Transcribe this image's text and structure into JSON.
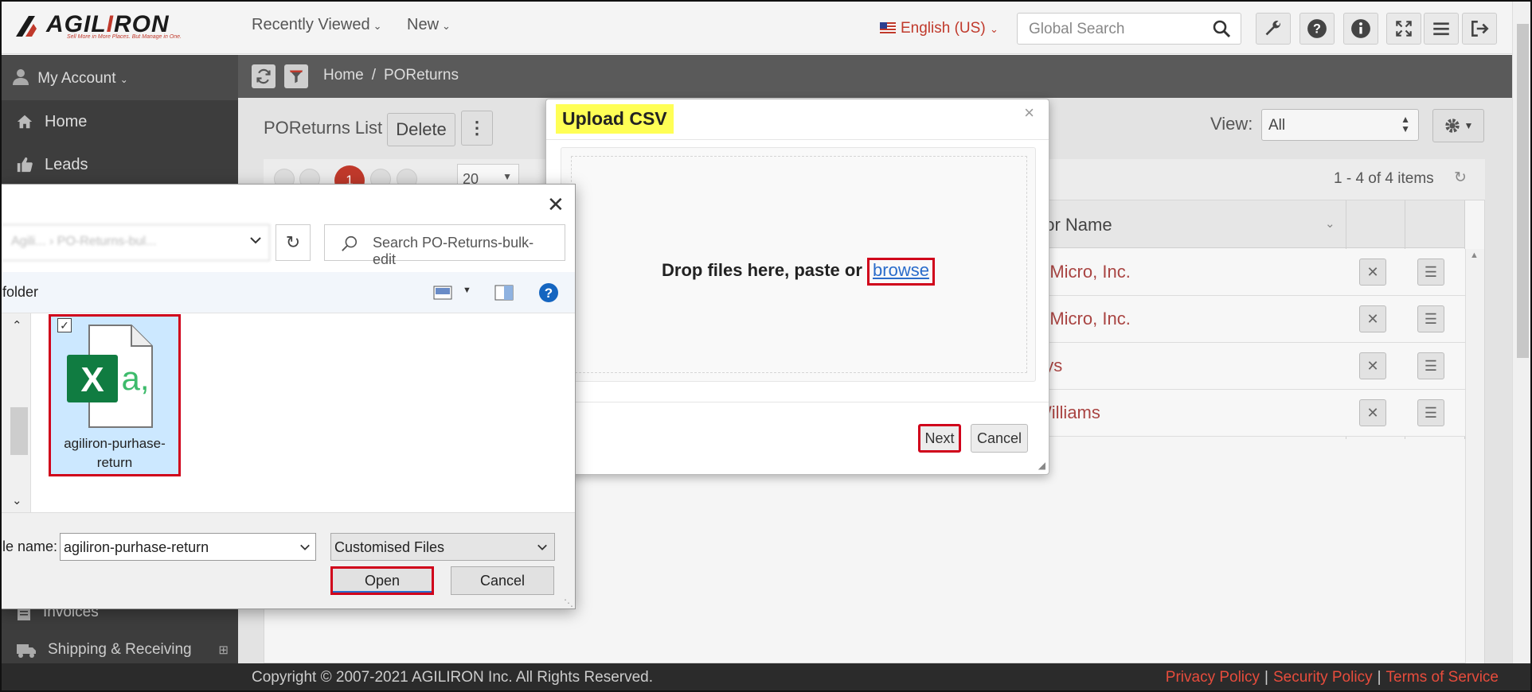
{
  "header": {
    "brand_left": "AGIL",
    "brand_accent": "I",
    "brand_right": "RON",
    "tagline": "Sell More in More Places. But Manage in One.",
    "nav": [
      "Recently Viewed",
      "New"
    ],
    "language": "English (US)",
    "search_placeholder": "Global Search",
    "icons": [
      "wrench-icon",
      "help-icon",
      "info-icon",
      "expand-icon",
      "menu-icon",
      "logout-icon"
    ]
  },
  "sidebar": {
    "account": "My Account",
    "items": [
      "Home",
      "Leads"
    ],
    "bottom_items": [
      "Invoices",
      "Shipping & Receiving"
    ]
  },
  "breadcrumb": {
    "home": "Home",
    "sep": "/",
    "current": "POReturns"
  },
  "list": {
    "title": "POReturns List",
    "delete_label": "Delete",
    "view_label": "View:",
    "view_value": "All",
    "page_size": "20",
    "current_page": "1",
    "count": "1 - 4 of 4 items",
    "column_header": "dor Name",
    "rows": [
      "d Micro, Inc.",
      "d Micro, Inc.",
      "nys",
      "Williams"
    ]
  },
  "modal": {
    "title": "Upload CSV",
    "close": "×",
    "drop_text": "Drop files here, paste or ",
    "browse": "browse",
    "next": "Next",
    "cancel": "Cancel"
  },
  "file_dialog": {
    "close": "✕",
    "path": "Agili... › PO-Returns-bul...",
    "search_placeholder": "Search PO-Returns-bulk-edit",
    "folder_label": "folder",
    "file_name": "agiliron-purhase-return",
    "file_name_line1": "agiliron-purhase-",
    "file_name_line2": "return",
    "file_name_label": "le name:",
    "file_type": "Customised Files",
    "open": "Open",
    "cancel": "Cancel"
  },
  "footer": {
    "copyright": "Copyright © 2007-2021 AGILIRON Inc. All Rights Reserved.",
    "privacy": "Privacy Policy",
    "security": "Security Policy",
    "terms": "Terms of Service",
    "separator": "|"
  },
  "colors": {
    "accent_red": "#c0392b",
    "highlight": "#ffff55",
    "excel_green": "#107c41"
  }
}
